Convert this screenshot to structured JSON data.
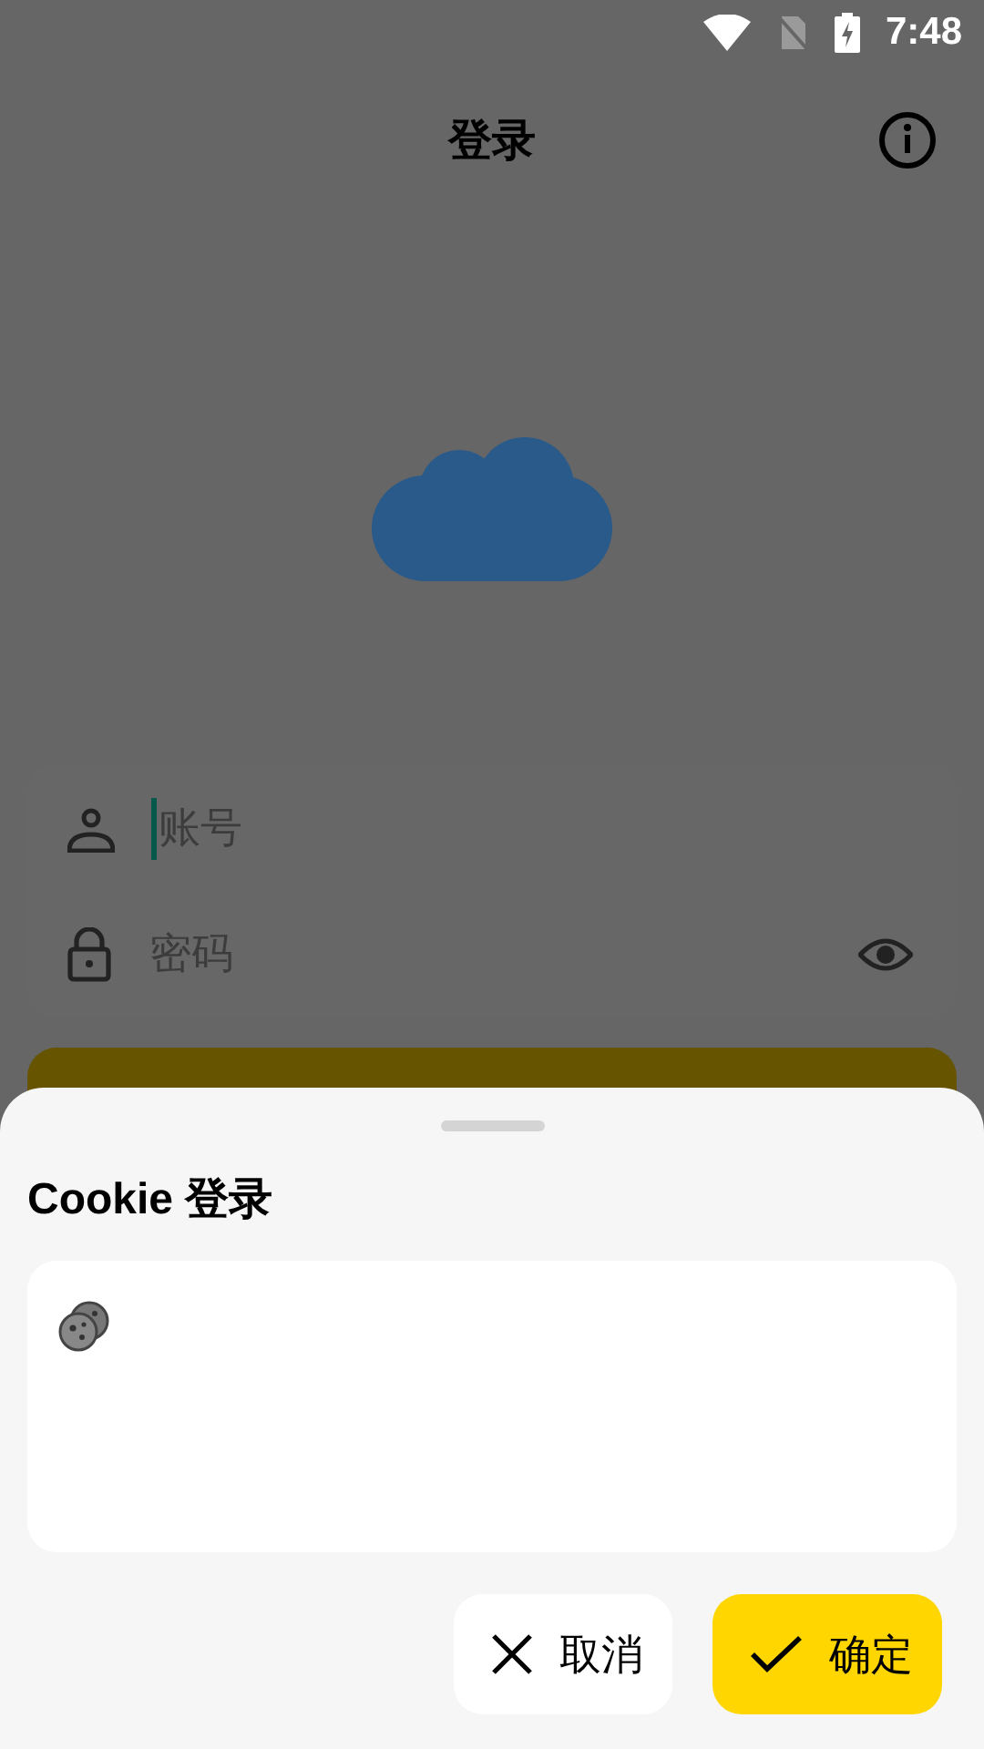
{
  "status_bar": {
    "time": "7:48"
  },
  "app_bar": {
    "title": "登录"
  },
  "login_form": {
    "fields": [
      {
        "kind": "account",
        "placeholder": "账号",
        "focused": true
      },
      {
        "kind": "password",
        "placeholder": "密码",
        "focused": false
      }
    ]
  },
  "bottom_sheet": {
    "title": "Cookie 登录",
    "buttons": [
      {
        "kind": "cancel",
        "label": "取消"
      },
      {
        "kind": "confirm",
        "label": "确定"
      }
    ]
  }
}
